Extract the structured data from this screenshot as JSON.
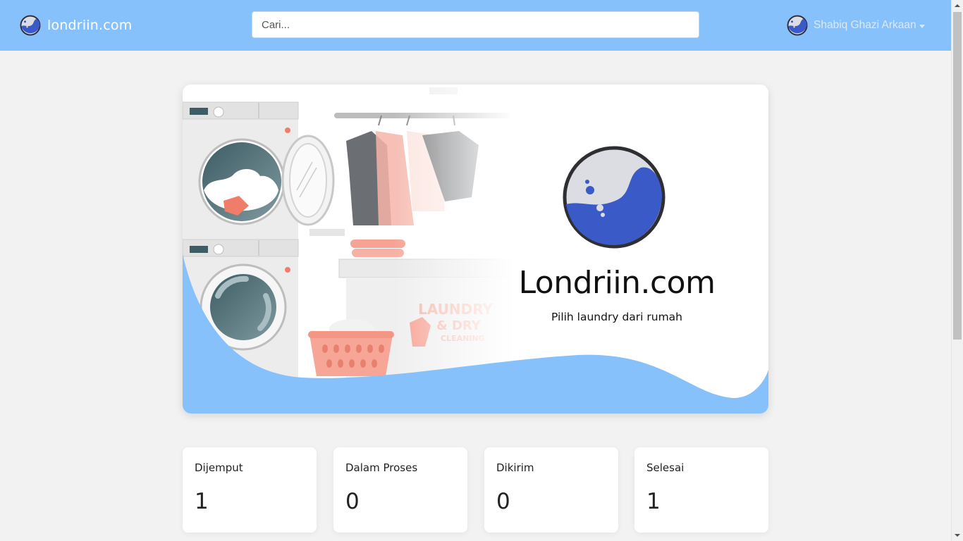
{
  "navbar": {
    "brand": "londriin.com",
    "search_placeholder": "Cari...",
    "user_name": "Shabiq Ghazi Arkaan"
  },
  "hero": {
    "title": "Londriin.com",
    "subtitle": "Pilih laundry dari rumah",
    "illustration_sign": "LAUNDRY & DRY CLEANING"
  },
  "stats": [
    {
      "label": "Dijemput",
      "value": "1"
    },
    {
      "label": "Dalam Proses",
      "value": "0"
    },
    {
      "label": "Dikirim",
      "value": "0"
    },
    {
      "label": "Selesai",
      "value": "1"
    }
  ],
  "colors": {
    "navbar": "#86c1fc",
    "accent_blue": "#3a5bc7",
    "background": "#f2f2f2",
    "card": "#ffffff"
  },
  "icons": {
    "logo": "wave-circle-logo",
    "user_menu": "caret-down-icon"
  }
}
